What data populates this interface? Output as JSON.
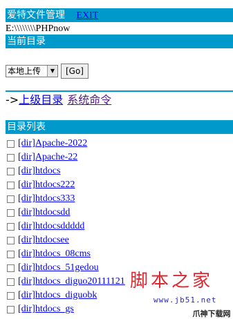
{
  "header": {
    "title": "爱特文件管理",
    "exit_label": "EXIT"
  },
  "current_path": "E:\\\\\\\\\\\\\\\\PHPnow",
  "current_dir_header": "当前目录",
  "toolbar": {
    "selected_option": "本地上传",
    "go_label": "[Go]"
  },
  "nav": {
    "prefix": "->",
    "parent_label": "上级目录",
    "command_label": "系统命令"
  },
  "list_header": "目录列表",
  "items": [
    "[dir]Apache-2022",
    "[dir]Apache-22",
    "[dir]htdocs",
    "[dir]htdocs222",
    "[dir]htdocs333",
    "[dir]htdocsdd",
    "[dir]htdocsddddd",
    "[dir]htdocsee",
    "[dir]htdocs_08cms",
    "[dir]htdocs_51gedou",
    "[dir]htdocs_diguo20111121",
    "[dir]htdocs_diguobk",
    "[dir]htdocs_gs"
  ],
  "watermark": {
    "brand": "脚本之家",
    "url": "www.jb51.net",
    "corner": "爪神下载网"
  }
}
